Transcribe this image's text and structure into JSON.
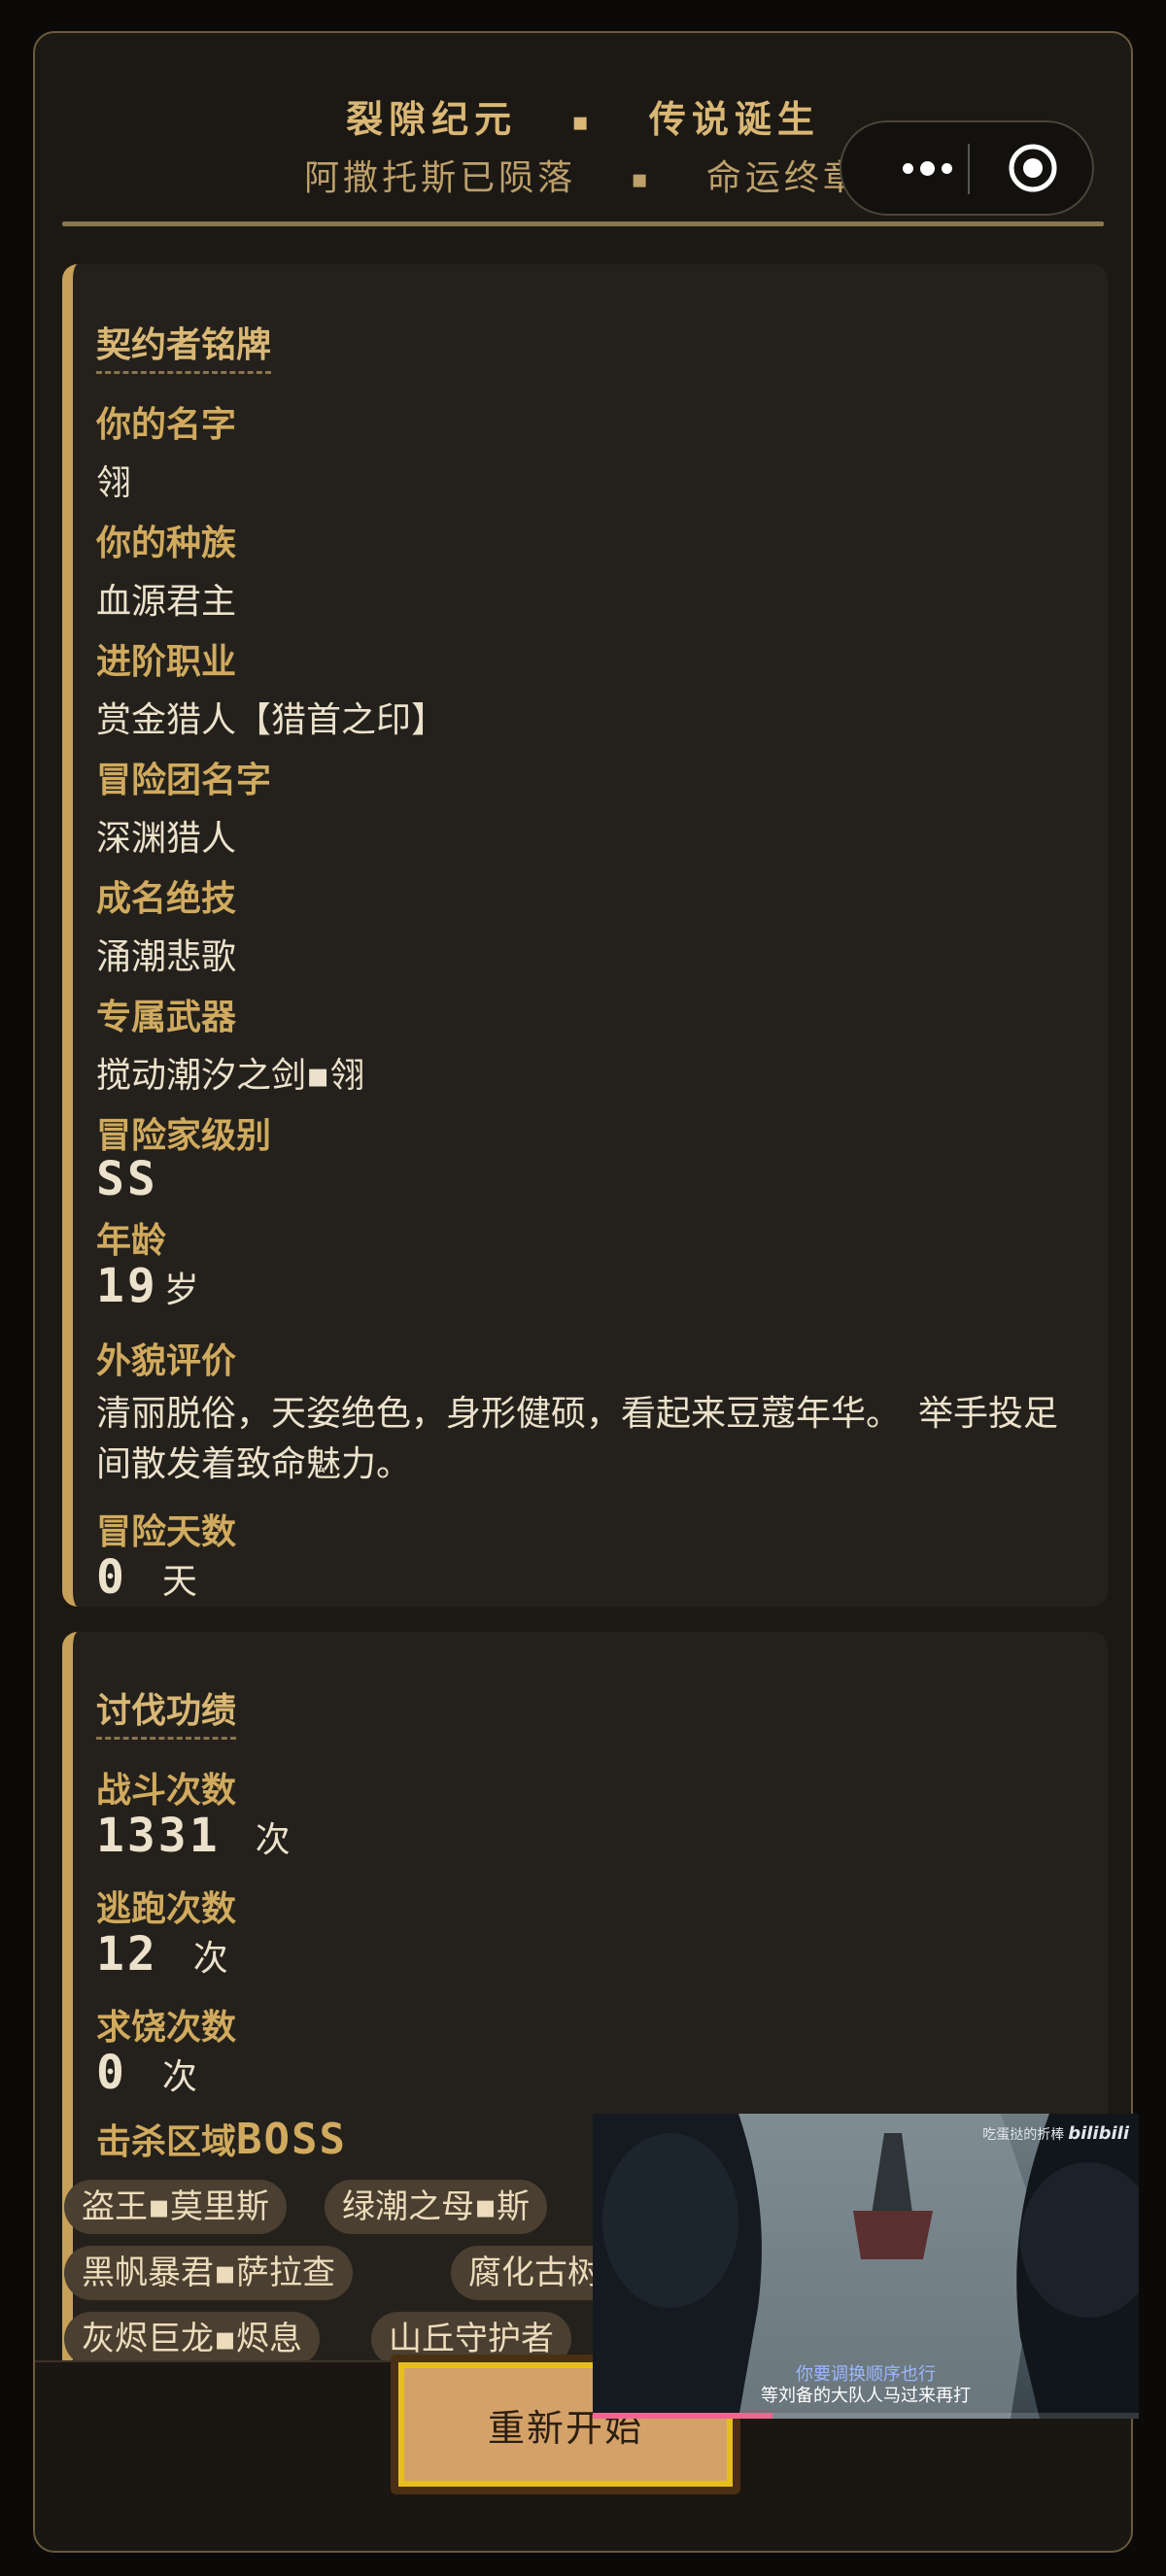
{
  "header": {
    "line1_left": "裂隙纪元",
    "line1_sep": "▪",
    "line1_right": "传说诞生",
    "line2_left": "阿撒托斯已陨落",
    "line2_sep": "▪",
    "line2_right": "命运终章"
  },
  "capsule": {
    "more_icon": "more-dots-icon",
    "close_icon": "target-circle-icon"
  },
  "card1": {
    "title": "契约者铭牌",
    "name_label": "你的名字",
    "name_value": "翎",
    "race_label": "你的种族",
    "race_value": "血源君主",
    "job_label": "进阶职业",
    "job_value": "赏金猎人【猎首之印】",
    "team_label": "冒险团名字",
    "team_value": "深渊猎人",
    "skill_label": "成名绝技",
    "skill_value": "涌潮悲歌",
    "weapon_label": "专属武器",
    "weapon_value": "搅动潮汐之剑▪翎",
    "rank_label": "冒险家级别",
    "rank_value": "SS",
    "age_label": "年龄",
    "age_value": "19",
    "age_unit": "岁",
    "looks_label": "外貌评价",
    "looks_value": "清丽脱俗，天姿绝色，身形健硕，看起来豆蔻年华。　举手投足间散发着致命魅力。",
    "days_label": "冒险天数",
    "days_value": "0",
    "days_unit": "天"
  },
  "card2": {
    "title": "讨伐功绩",
    "battle_label": "战斗次数",
    "battle_value": "1331",
    "battle_unit": "次",
    "flee_label": "逃跑次数",
    "flee_value": "12",
    "flee_unit": "次",
    "beg_label": "求饶次数",
    "beg_value": "0",
    "beg_unit": "次",
    "boss_label_a": "击杀区域",
    "boss_label_b": "BOSS",
    "tags": [
      "盗王▪莫里斯",
      "绿潮之母▪斯",
      "黑帆暴君▪萨拉查",
      "腐化古树",
      "灰烬巨龙▪烬息",
      "山丘守护者"
    ]
  },
  "footer": {
    "restart_label": "重新开始"
  },
  "video": {
    "brand": "吃蛋挞的折棒",
    "logo": "bilibili",
    "subtitle_top": "你要调换顺序也行",
    "subtitle_bottom": "等刘备的大队人马过来再打",
    "progress": 0.33
  }
}
